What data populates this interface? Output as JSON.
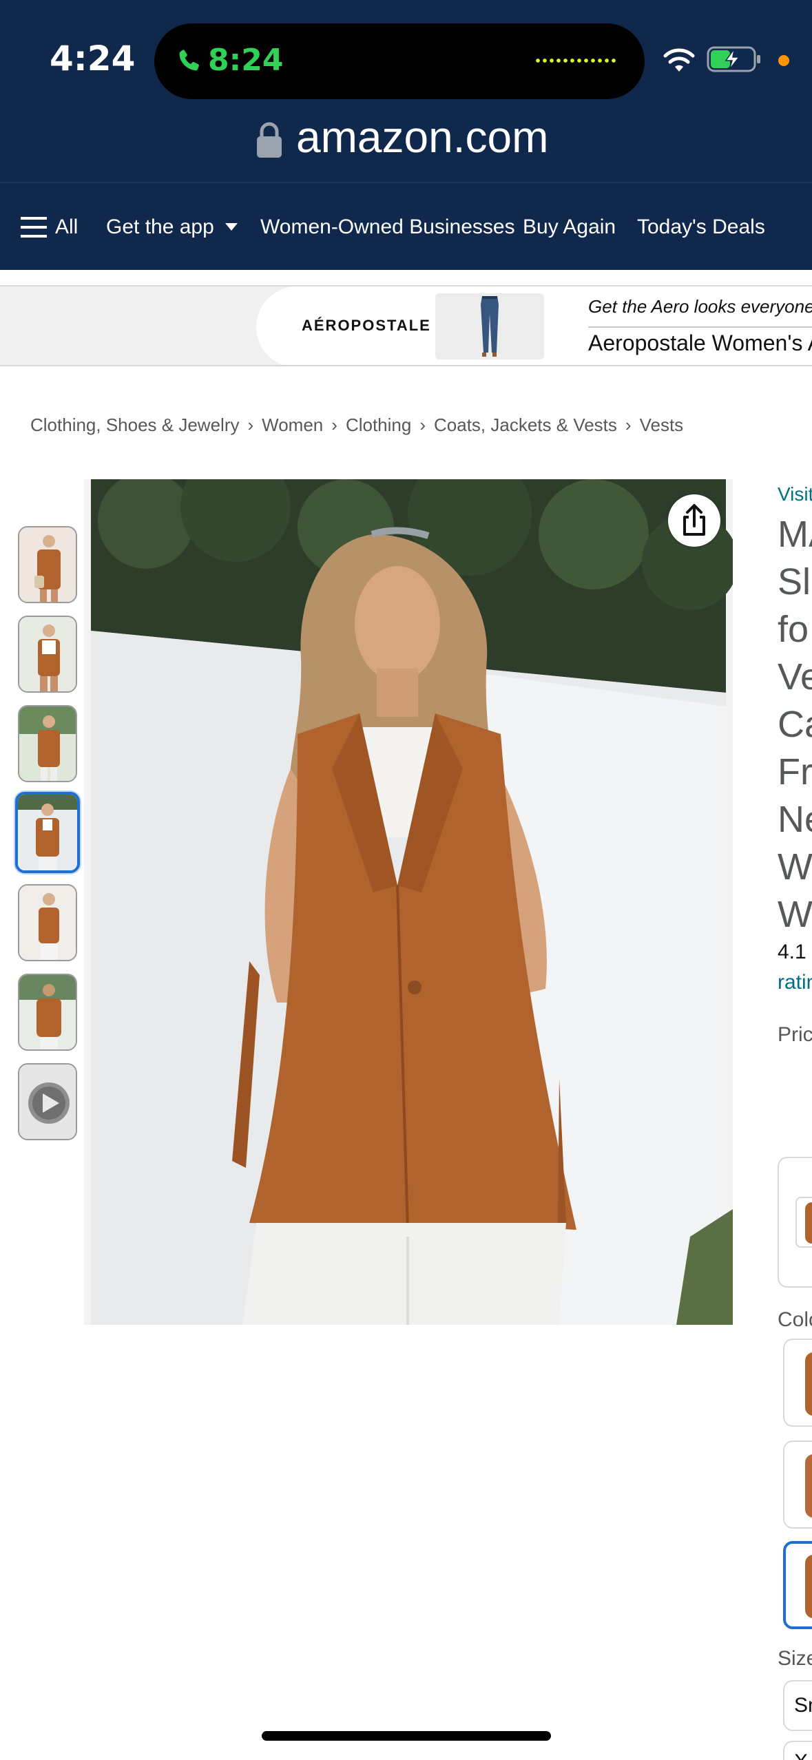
{
  "status_bar": {
    "time": "4:24",
    "call_time": "8:24"
  },
  "browser": {
    "url": "amazon.com"
  },
  "nav": {
    "all_label": "All",
    "get_app_label": "Get the app",
    "women_owned_label": "Women-Owned Businesses",
    "buy_again_label": "Buy Again",
    "todays_deals_label": "Today's Deals"
  },
  "ad": {
    "brand": "AÉROPOSTALE",
    "tagline": "Get the Aero looks everyone",
    "title": "Aeropostale Women's A"
  },
  "breadcrumb": [
    "Clothing, Shoes & Jewelry",
    "Women",
    "Clothing",
    "Coats, Jackets & Vests",
    "Vests"
  ],
  "thumbnails": {
    "count": 7,
    "selected_index": 3
  },
  "product": {
    "visit_link": "Visit",
    "title_lines": [
      "MA",
      "Sle",
      "fo",
      "Ve",
      "Ca",
      "Fr",
      "Ne",
      "Wo",
      "Wa"
    ],
    "rating": "4.1",
    "ratings_link": "ratin",
    "price_label": "Pric",
    "color_label": "Colo",
    "size_label": "Size",
    "size_option": "Sm",
    "size_option_2": "X"
  },
  "colors": {
    "nav_bg": "#10284b",
    "link": "#007185",
    "vest": "#b0632c",
    "selection": "#1f6fd1"
  }
}
